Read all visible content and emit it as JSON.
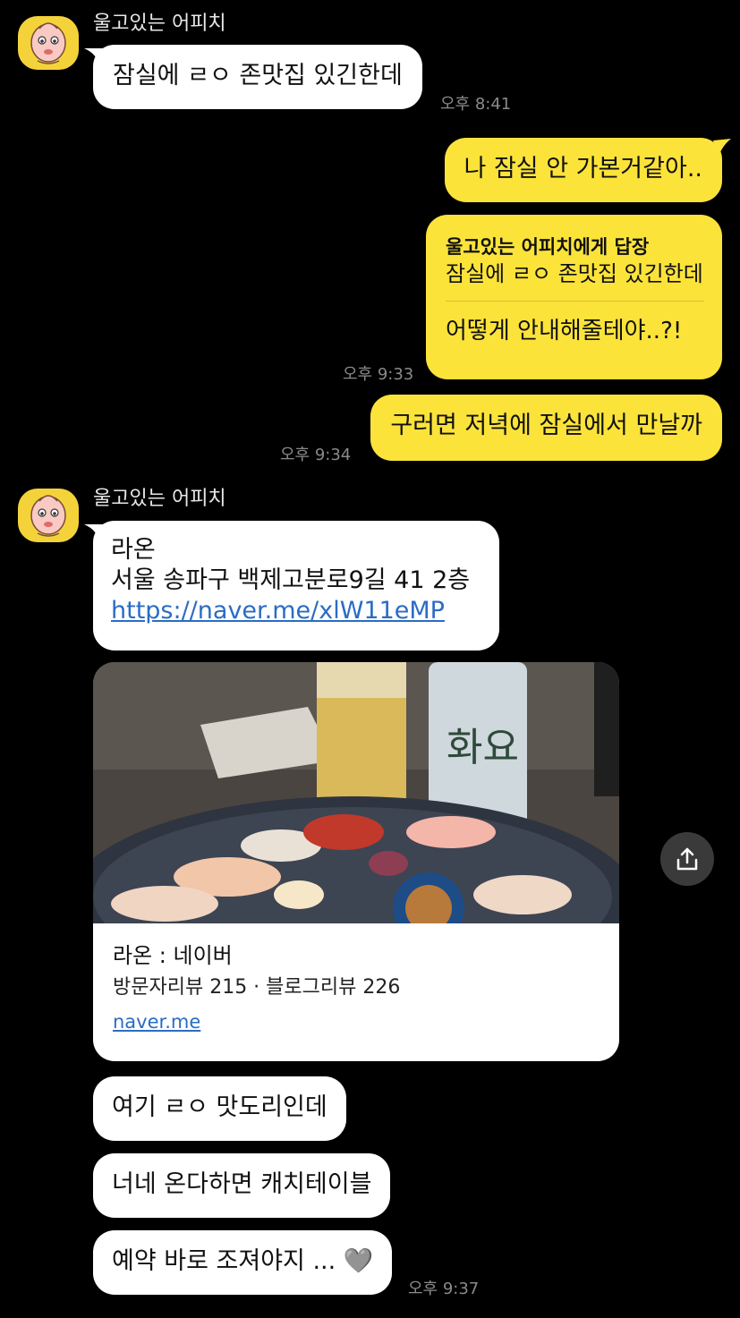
{
  "sender_name": "울고있는 어피치",
  "messages": {
    "m1": "잠실에 ㄹㅇ 존맛집 있긴한데",
    "m1_time": "오후 8:41",
    "m2": "나 잠실 안 가본거같아..",
    "reply_header": "울고있는 어피치에게 답장",
    "reply_quote": "잠실에 ㄹㅇ 존맛집 있긴한데",
    "reply_text": "어떻게 안내해줄테야..?!",
    "m3_time": "오후 9:33",
    "m4": "구러면 저녁에 잠실에서 만날까",
    "m4_time": "오후 9:34",
    "place_name": "라온",
    "place_address": "서울 송파구 백제고분로9길 41 2층",
    "place_url": "https://naver.me/xlW11eMP",
    "card_title": "라온 : 네이버",
    "card_desc": "방문자리뷰 215 · 블로그리뷰 226",
    "card_domain": "naver.me",
    "m5": "여기 ㄹㅇ 맛도리인데",
    "m6": "너네 온다하면 캐치테이블",
    "m7": "예약 바로 조져야지 ...",
    "m7_emoji": "🩶",
    "m7_time": "오후 9:37"
  },
  "icons": {
    "share": "share-icon",
    "avatar": "apeach-avatar"
  },
  "colors": {
    "background": "#000000",
    "outgoing_bubble": "#fbe33a",
    "incoming_bubble": "#ffffff",
    "link": "#2b6cc4",
    "avatar_bg": "#f4d33a"
  }
}
